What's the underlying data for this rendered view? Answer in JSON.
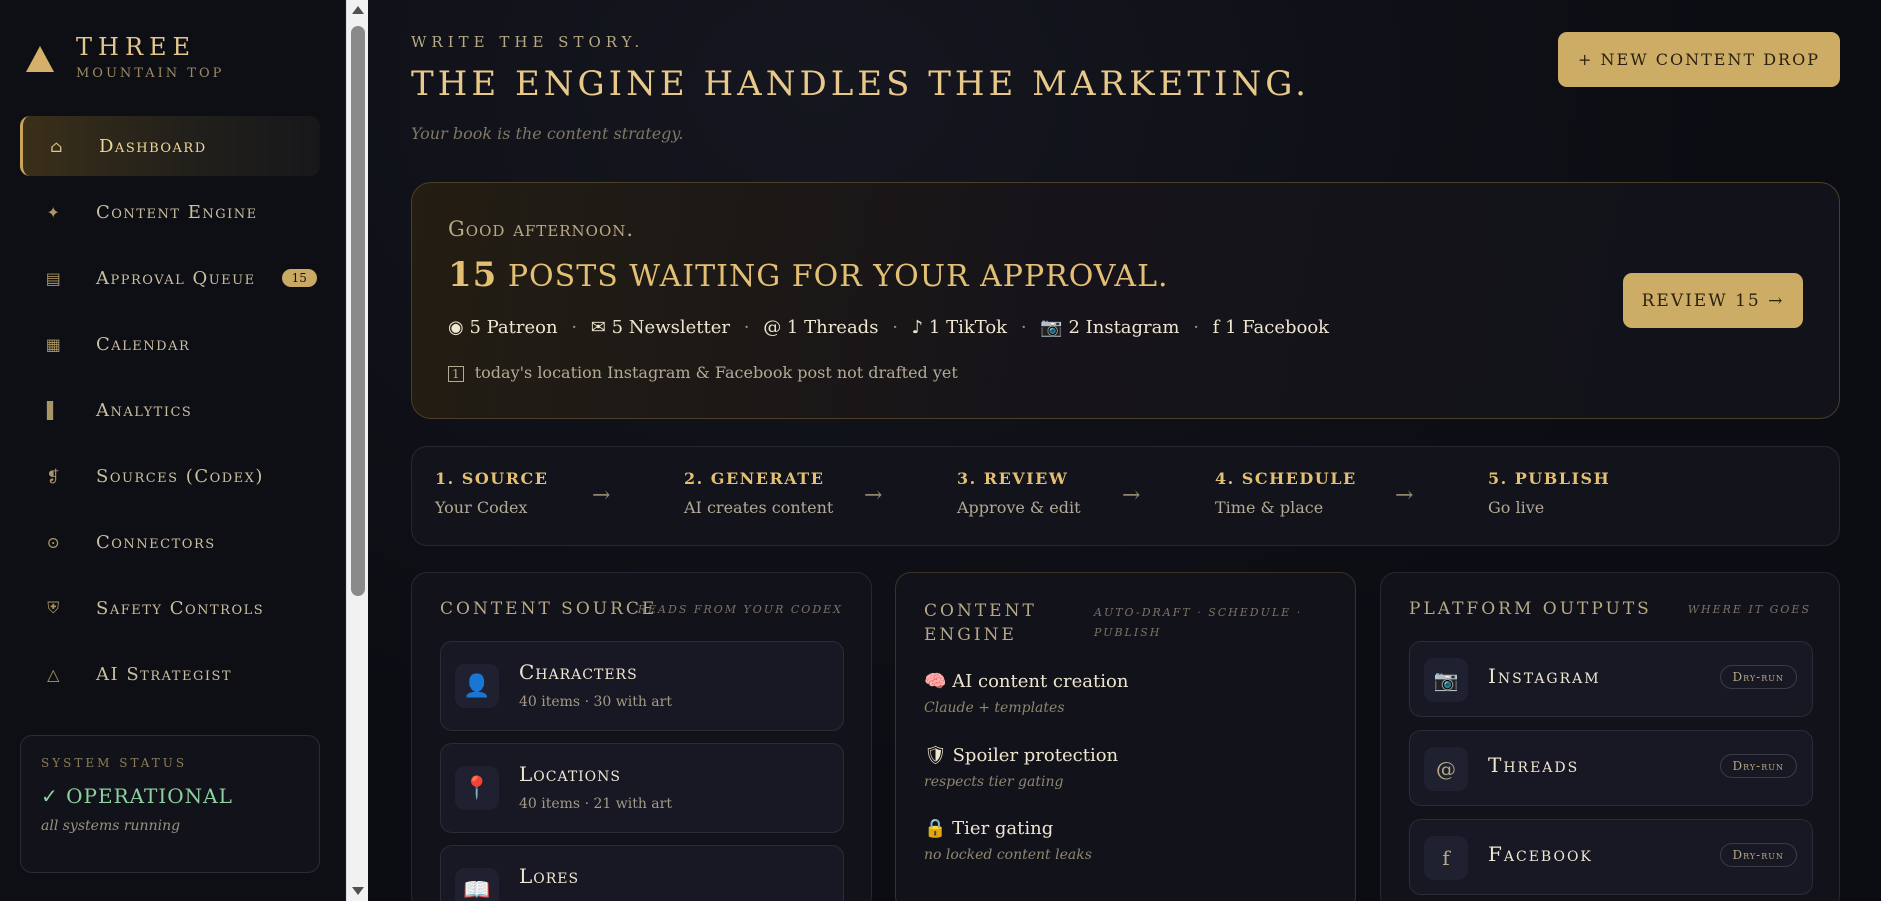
{
  "brand": {
    "name": "THREE",
    "sub": "MOUNTAIN TOP"
  },
  "sidebar": {
    "items": [
      {
        "label": "Dashboard",
        "icon": "home-icon",
        "glyph": "⌂"
      },
      {
        "label": "Content Engine",
        "icon": "sparkle-icon",
        "glyph": "✦"
      },
      {
        "label": "Approval Queue",
        "icon": "queue-icon",
        "glyph": "▤",
        "badge": "15"
      },
      {
        "label": "Calendar",
        "icon": "calendar-icon",
        "glyph": "▦"
      },
      {
        "label": "Analytics",
        "icon": "bar-icon",
        "glyph": "▌"
      },
      {
        "label": "Sources (Codex)",
        "icon": "codex-icon",
        "glyph": "❡"
      },
      {
        "label": "Connectors",
        "icon": "connector-icon",
        "glyph": "⊙"
      },
      {
        "label": "Safety Controls",
        "icon": "shield-icon",
        "glyph": "⛨"
      },
      {
        "label": "AI Strategist",
        "icon": "triangle-icon",
        "glyph": "△"
      }
    ]
  },
  "status": {
    "title": "SYSTEM STATUS",
    "check": "✓",
    "value": "OPERATIONAL",
    "sub": "all systems running"
  },
  "header": {
    "eyebrow": "WRITE THE STORY.",
    "headline": "THE ENGINE HANDLES THE MARKETING.",
    "tagline": "Your book is the content strategy.",
    "new_button": "+ NEW CONTENT DROP"
  },
  "hero": {
    "greeting": "Good afternoon.",
    "count": "15",
    "title_rest": "POSTS WAITING FOR YOUR APPROVAL.",
    "channels": [
      {
        "glyph": "◉",
        "text": "5 Patreon"
      },
      {
        "glyph": "✉",
        "text": "5 Newsletter"
      },
      {
        "glyph": "@",
        "text": "1 Threads"
      },
      {
        "glyph": "♪",
        "text": "1 TikTok"
      },
      {
        "glyph": "📷",
        "text": "2 Instagram"
      },
      {
        "glyph": "f",
        "text": "1 Facebook"
      }
    ],
    "separator": "·",
    "note_icon": "1",
    "note": "today's location Instagram & Facebook post not drafted yet",
    "review_button": "REVIEW 15 →"
  },
  "pipeline": {
    "arrow": "→",
    "steps": [
      {
        "title": "1. SOURCE",
        "sub": "Your Codex"
      },
      {
        "title": "2. GENERATE",
        "sub": "AI creates content"
      },
      {
        "title": "3. REVIEW",
        "sub": "Approve & edit"
      },
      {
        "title": "4. SCHEDULE",
        "sub": "Time & place"
      },
      {
        "title": "5. PUBLISH",
        "sub": "Go live"
      }
    ]
  },
  "source_card": {
    "title": "CONTENT SOURCE",
    "hint": "READS FROM YOUR CODEX",
    "items": [
      {
        "glyph": "👤",
        "title": "Characters",
        "sub": "40 items · 30 with art"
      },
      {
        "glyph": "📍",
        "title": "Locations",
        "sub": "40 items · 21 with art"
      },
      {
        "glyph": "📖",
        "title": "Lores",
        "sub": ""
      }
    ]
  },
  "engine_card": {
    "title_line1": "CONTENT",
    "title_line2": "ENGINE",
    "hint_line1": "AUTO-DRAFT · SCHEDULE ·",
    "hint_line2": "PUBLISH",
    "items": [
      {
        "glyph": "🧠",
        "title": "AI content creation",
        "sub": "Claude + templates"
      },
      {
        "glyph": "🛡",
        "title": "Spoiler protection",
        "sub": "respects tier gating"
      },
      {
        "glyph": "🔒",
        "title": "Tier gating",
        "sub": "no locked content leaks"
      }
    ]
  },
  "platform_card": {
    "title": "PLATFORM OUTPUTS",
    "hint": "WHERE IT GOES",
    "items": [
      {
        "glyph": "📷",
        "name": "Instagram",
        "badge": "Dry-run"
      },
      {
        "glyph": "@",
        "name": "Threads",
        "badge": "Dry-run"
      },
      {
        "glyph": "f",
        "name": "Facebook",
        "badge": "Dry-run"
      }
    ]
  },
  "colors": {
    "accent": "#cdac66",
    "background": "#0c0d13",
    "status_ok": "#8fd0a0"
  }
}
